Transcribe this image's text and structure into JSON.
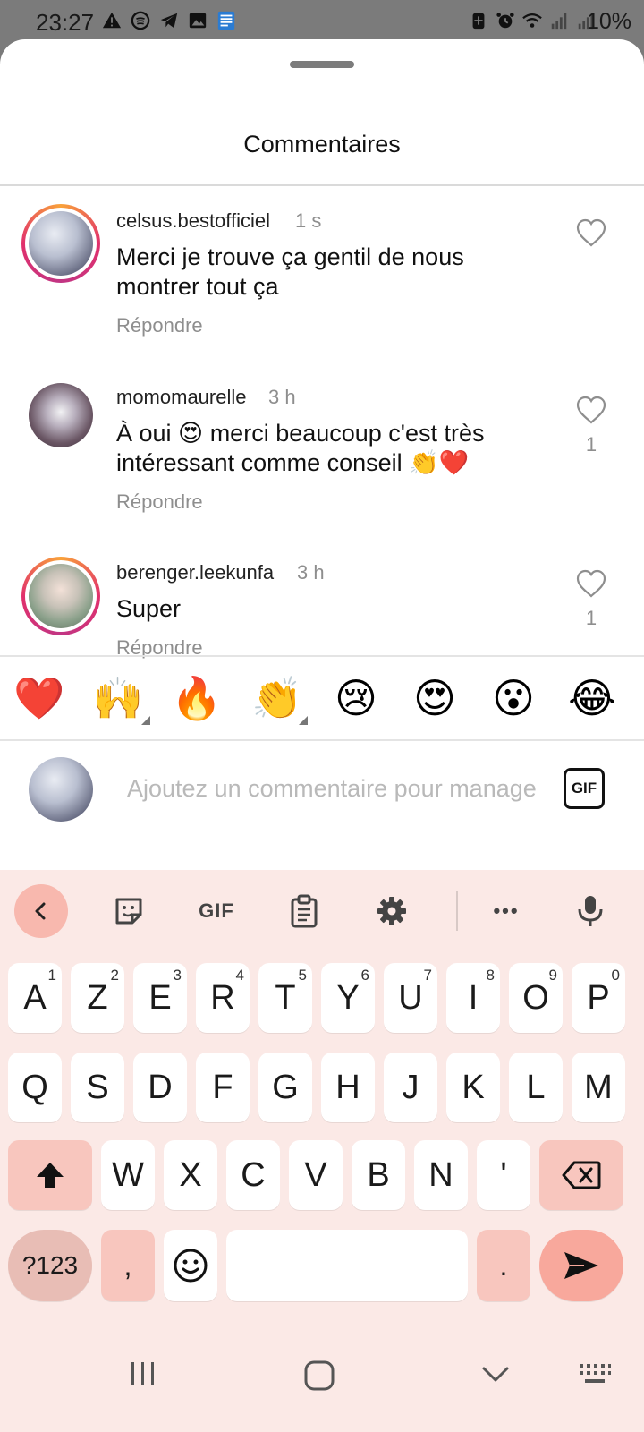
{
  "status_bar": {
    "time": "23:27",
    "battery": "10%",
    "left_icons": [
      "warning-icon",
      "spotify-icon",
      "telegram-icon",
      "gallery-icon",
      "word-icon"
    ],
    "right_icons": [
      "battery-saver-icon",
      "alarm-icon",
      "wifi-icon",
      "signal-icon",
      "signal-icon"
    ]
  },
  "sheet": {
    "title": "Commentaires"
  },
  "comments": [
    {
      "username": "celsus.bestofficiel",
      "time": "1 s",
      "text": "Merci je trouve ça gentil de nous montrer tout ça",
      "reply_label": "Répondre",
      "likes": ""
    },
    {
      "username": "momomaurelle",
      "time": "3 h",
      "text": "À oui 😍 merci beaucoup c'est très intéressant comme conseil 👏❤️",
      "reply_label": "Répondre",
      "likes": "1"
    },
    {
      "username": "berenger.leekunfa",
      "time": "3 h",
      "text": "Super",
      "reply_label": "Répondre",
      "likes": "1"
    }
  ],
  "emoji_bar": [
    "❤️",
    "🙌",
    "🔥",
    "👏",
    "😢",
    "😍",
    "😮",
    "😂"
  ],
  "input": {
    "placeholder": "Ajoutez un commentaire pour manage",
    "gif_label": "GIF"
  },
  "keyboard": {
    "toolbar": {
      "gif_label": "GIF",
      "more_label": "•••"
    },
    "row1": [
      {
        "k": "A",
        "n": "1"
      },
      {
        "k": "Z",
        "n": "2"
      },
      {
        "k": "E",
        "n": "3"
      },
      {
        "k": "R",
        "n": "4"
      },
      {
        "k": "T",
        "n": "5"
      },
      {
        "k": "Y",
        "n": "6"
      },
      {
        "k": "U",
        "n": "7"
      },
      {
        "k": "I",
        "n": "8"
      },
      {
        "k": "O",
        "n": "9"
      },
      {
        "k": "P",
        "n": "0"
      }
    ],
    "row2": [
      "Q",
      "S",
      "D",
      "F",
      "G",
      "H",
      "J",
      "K",
      "L",
      "M"
    ],
    "row3": [
      "W",
      "X",
      "C",
      "V",
      "B",
      "N",
      "'"
    ],
    "mode_label": "?123",
    "comma": ",",
    "period": "."
  },
  "colors": {
    "keyboard_bg": "#fbe9e6",
    "accent_key": "#f8b8ae",
    "story_ring_start": "#f9a23a",
    "story_ring_end": "#c13584"
  }
}
